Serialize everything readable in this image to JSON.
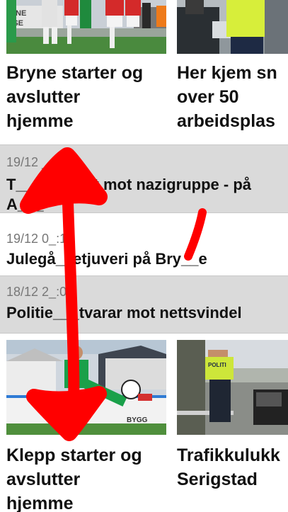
{
  "cards_top": [
    {
      "title": "Bryne starter og\navslutter\nhjemme",
      "image": "football-players-photo"
    },
    {
      "title": "Her kjem sn\nover 50\narbeidsplas",
      "image": "officials-in-hi-vis-photo"
    }
  ],
  "news_list": [
    {
      "date": "19/12 __:45",
      "headline": "T_______est mot nazigruppe - på\nA___"
    },
    {
      "date": "19/12 0_:13",
      "headline": "Julegå__etjuveri på Bry__e"
    },
    {
      "date": "18/12 2_:00",
      "headline": "Politie___tvarar mot nettsvindel"
    }
  ],
  "cards_bottom": [
    {
      "title": "Klepp starter og\navslutter\nhjemme",
      "image": "football-overhead-kick-photo",
      "board_text": "BYGG"
    },
    {
      "title": "Trafikkulukk\nSerigstad",
      "image": "police-at-car-crash-photo",
      "vest_text": "POLITI"
    }
  ],
  "annotation": {
    "color": "#ff0000",
    "description": "red hand-drawn arrow"
  }
}
